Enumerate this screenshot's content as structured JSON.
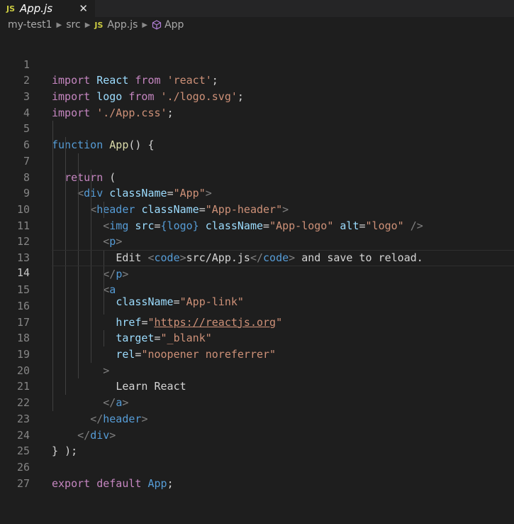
{
  "tab": {
    "icon": "JS",
    "filename": "App.js",
    "close": "✕"
  },
  "breadcrumbs": {
    "folder": "my-test1",
    "subfolder": "src",
    "file_icon": "JS",
    "file": "App.js",
    "symbol": "App"
  },
  "code": {
    "lines": [
      "1",
      "2",
      "3",
      "4",
      "5",
      "6",
      "7",
      "8",
      "9",
      "10",
      "11",
      "12",
      "13",
      "14",
      "15",
      "16",
      "17",
      "18",
      "19",
      "20",
      "21",
      "22",
      "23",
      "24",
      "25",
      "26",
      "27"
    ],
    "tokens": {
      "import": "import",
      "react_id": "React",
      "from": "from",
      "react_str": "'react'",
      "logo_id": "logo",
      "logo_str": "'./logo.svg'",
      "css_str": "'./App.css'",
      "function": "function",
      "app_fn": "App",
      "return": "return",
      "div": "div",
      "classname": "className",
      "app_str": "\"App\"",
      "header": "header",
      "header_str": "\"App-header\"",
      "img": "img",
      "src": "src",
      "logo_brace": "{logo}",
      "applogo_str": "\"App-logo\"",
      "alt": "alt",
      "logo_alt_str": "\"logo\"",
      "p": "p",
      "edit": "Edit ",
      "code": "code",
      "src_path": "src/App.js",
      "save_text": " and save to reload.",
      "a": "a",
      "applink_str": "\"App-link\"",
      "href": "href",
      "url": "https://reactjs.org",
      "target": "target",
      "blank_str": "\"_blank\"",
      "rel": "rel",
      "noopener_str": "\"noopener noreferrer\"",
      "learn": "Learn React",
      "export": "export",
      "default": "default"
    }
  },
  "colors": {
    "background": "#1e1e1e",
    "keyword": "#c586c0",
    "string": "#ce9178",
    "tag": "#569cd6",
    "attribute": "#9cdcfe",
    "function": "#dcdcaa"
  }
}
